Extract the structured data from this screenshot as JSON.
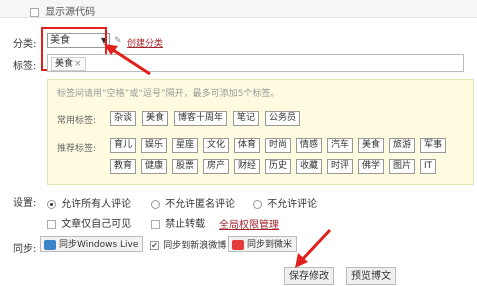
{
  "top": {
    "show_source_label": "显示源代码"
  },
  "category": {
    "label": "分类:",
    "selected": "美食",
    "create_link": "创建分类"
  },
  "tags": {
    "label": "标签:",
    "chip": "美食",
    "chip_remove": "×",
    "hint": "标签间请用“空格”或“逗号”隔开，最多可添加5个标签。",
    "common_label": "常用标签:",
    "common": [
      "杂谈",
      "美食",
      "博客十周年",
      "笔记",
      "公务员"
    ],
    "recommend_label": "推荐标签:",
    "recommend_row1": [
      "育儿",
      "娱乐",
      "星座",
      "文化",
      "体育",
      "时尚",
      "情感",
      "汽车",
      "美食",
      "旅游",
      "军事"
    ],
    "recommend_row2": [
      "教育",
      "健康",
      "股票",
      "房产",
      "财经",
      "历史",
      "收藏",
      "时评",
      "佛学",
      "图片",
      "IT"
    ]
  },
  "settings": {
    "label": "设置:",
    "comment_all": "允许所有人评论",
    "comment_no_anon": "不允许匿名评论",
    "comment_none": "不允许评论",
    "self_only": "文章仅自己可见",
    "no_repost": "禁止转载",
    "permission_link": "全局权限管理"
  },
  "sync": {
    "label": "同步:",
    "windows_live": "同步Windows Live",
    "sina_weibo": "同步到新浪微博",
    "weimi": "同步到微米"
  },
  "actions": {
    "save": "保存修改",
    "preview": "预览博文"
  },
  "colors": {
    "annotation_red": "#e0201a",
    "link_red": "#a3262b",
    "panel_yellow": "#fffbe0"
  }
}
